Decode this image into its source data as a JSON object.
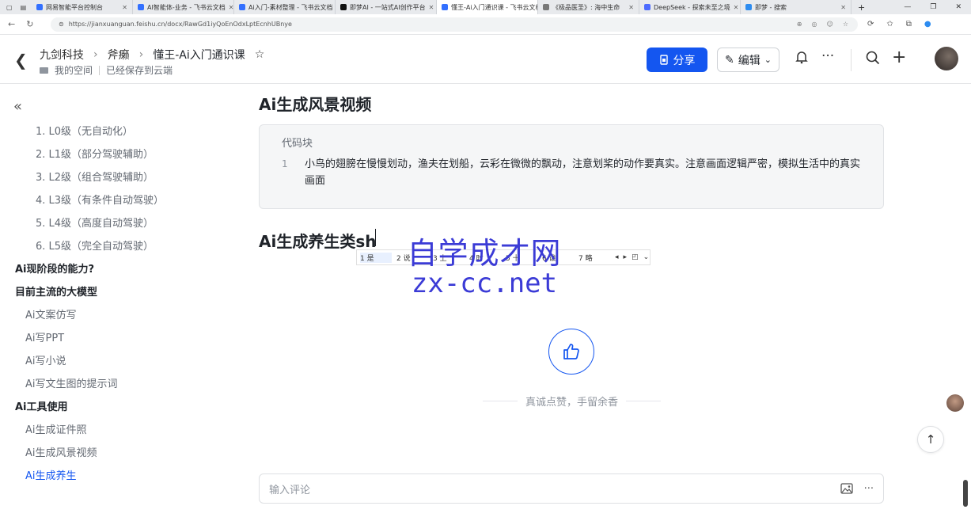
{
  "browser": {
    "tabs": [
      {
        "title": "网易智能平台控制台"
      },
      {
        "title": "AI智能体-业务 - 飞书云文档"
      },
      {
        "title": "Ai入门-素材整理 - 飞书云文档"
      },
      {
        "title": "即梦AI - 一站式AI创作平台"
      },
      {
        "title": "懂王-Ai入门通识课 - 飞书云文档"
      },
      {
        "title": "《极品医圣》: 海中生命"
      },
      {
        "title": "DeepSeek - 探索未至之境"
      },
      {
        "title": "即梦 - 搜索"
      }
    ],
    "url": "https://jianxuanguan.feishu.cn/docx/RawGd1iyQoEnOdxLptEcnhUBnye"
  },
  "header": {
    "breadcrumb": [
      "九剑科技",
      "斧癞",
      "懂王-Ai入门通识课"
    ],
    "space": "我的空间",
    "saved": "已经保存到云端",
    "share_label": "分享",
    "edit_label": "编辑"
  },
  "sidebar": {
    "items": [
      {
        "label": "1. L0级（无自动化）",
        "level": 1
      },
      {
        "label": "2. L1级（部分驾驶辅助）",
        "level": 1
      },
      {
        "label": "3. L2级（组合驾驶辅助）",
        "level": 1
      },
      {
        "label": "4. L3级（有条件自动驾驶）",
        "level": 1
      },
      {
        "label": "5. L4级（高度自动驾驶）",
        "level": 1
      },
      {
        "label": "6. L5级（完全自动驾驶）",
        "level": 1
      },
      {
        "label": "Ai现阶段的能力?",
        "level": 0
      },
      {
        "label": "目前主流的大模型",
        "level": 0
      },
      {
        "label": "Ai文案仿写",
        "level": 2
      },
      {
        "label": "Ai写PPT",
        "level": 2
      },
      {
        "label": "Ai写小说",
        "level": 2
      },
      {
        "label": "Ai写文生图的提示词",
        "level": 2
      },
      {
        "label": "Ai工具使用",
        "level": 0
      },
      {
        "label": "Ai生成证件照",
        "level": 2
      },
      {
        "label": "Ai生成风景视频",
        "level": 2
      },
      {
        "label": "Ai生成养生",
        "level": 2,
        "active": true
      }
    ]
  },
  "doc": {
    "heading1": "Ai生成风景视频",
    "code_label": "代码块",
    "code_line_no": "1",
    "code_text": "小鸟的翅膀在慢慢划动，渔夫在划船，云彩在微微的飘动，注意划桨的动作要真实。注意画面逻辑严密，模拟生活中的真实画面",
    "heading2": "Ai生成养生类sh",
    "ime_candidates": [
      "1 是",
      "2 说",
      "3 上",
      "4 时",
      "5 十",
      "6 谁",
      "7 略"
    ],
    "watermark_top": "自学成才网",
    "watermark_bottom": "zx-cc.net",
    "thanks": "真诚点赞，手留余香",
    "comment_placeholder": "输入评论"
  }
}
